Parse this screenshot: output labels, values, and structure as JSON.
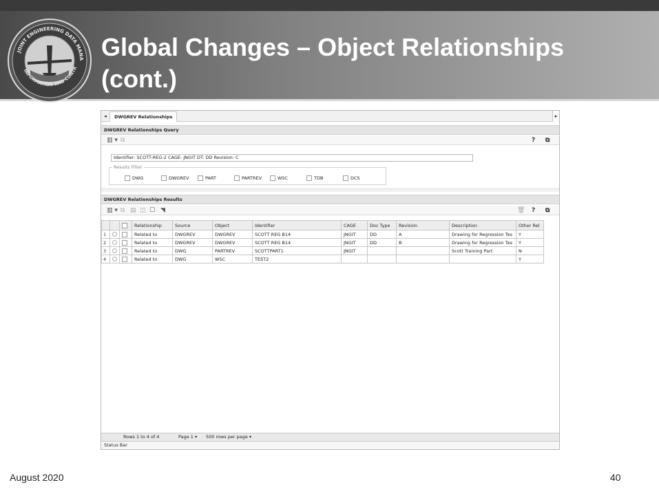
{
  "slide": {
    "title": "Global Changes – Object Relationships (cont.)",
    "footer_date": "August 2020",
    "page_number": "40",
    "logo_text": "JOINT ENGINEERING DATA MANAGEMENT INFORMATION AND CONTROL SYSTEM"
  },
  "app": {
    "tab_label": "DWGREV Relationships",
    "query_section": {
      "title": "DWGREV Relationships Query",
      "identifier_value": "Identifier: SCOTT-REG-2 CAGE: JNGIT DT: DD Revision: C",
      "filter_label": "Results Filter",
      "filters": [
        "DWG",
        "DWGREV",
        "PART",
        "PARTREV",
        "WSC",
        "TDB",
        "DCS"
      ]
    },
    "results_section": {
      "title": "DWGREV Relationships Results",
      "columns": [
        "Relationship",
        "Source",
        "Object",
        "Identifier",
        "CAGE",
        "Doc Type",
        "Revision",
        "Description",
        "Other Rel"
      ],
      "rows": [
        {
          "n": "1",
          "relationship": "Related to",
          "source": "DWGREV",
          "object": "DWGREV",
          "identifier": "SCOTT REG B14",
          "cage": "JNGIT",
          "doc_type": "DD",
          "revision": "A",
          "description": "Drawing for Regression Tes",
          "other_rel": "Y"
        },
        {
          "n": "2",
          "relationship": "Related to",
          "source": "DWGREV",
          "object": "DWGREV",
          "identifier": "SCOTT REG B14",
          "cage": "JNGIT",
          "doc_type": "DD",
          "revision": "B",
          "description": "Drawing for Regression Tes",
          "other_rel": "Y"
        },
        {
          "n": "3",
          "relationship": "Related to",
          "source": "DWG",
          "object": "PARTREV",
          "identifier": "SCOTTPART1",
          "cage": "JNGIT",
          "doc_type": "",
          "revision": "",
          "description": "Scott Training Part",
          "other_rel": "N"
        },
        {
          "n": "4",
          "relationship": "Related to",
          "source": "DWG",
          "object": "WSC",
          "identifier": "TEST2",
          "cage": "",
          "doc_type": "",
          "revision": "",
          "description": "",
          "other_rel": "Y"
        }
      ]
    },
    "pager": {
      "rows_text": "Rows 1 to 4 of 4",
      "page_text": "Page 1",
      "per_page_text": "500 rows per page"
    },
    "status_bar": "Status Bar",
    "help_glyph": "?"
  },
  "colors": {
    "header_dark": "#4a4a4a",
    "header_light": "#b0b0b0",
    "title_text": "#ffffff"
  }
}
